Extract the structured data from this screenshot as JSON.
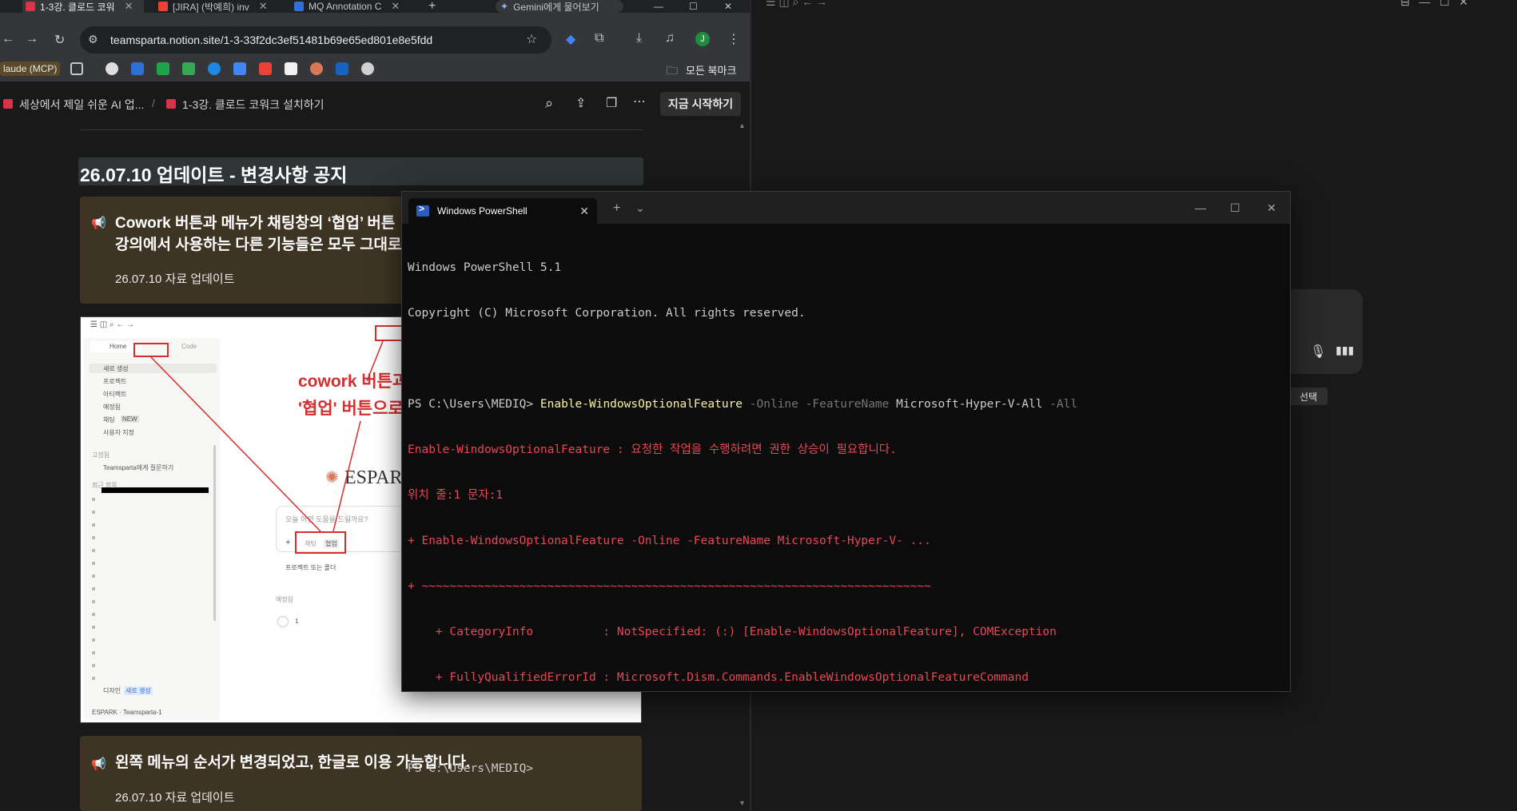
{
  "browser": {
    "tabs": [
      {
        "label": "1-3강. 클로드 코워",
        "active": true
      },
      {
        "label": "[JIRA] (박예희) inv",
        "active": false
      },
      {
        "label": "MQ Annotation C",
        "active": false
      }
    ],
    "gemini_label": "Gemini에게 물어보기",
    "url": "teamsparta.notion.site/1-3-33f2dc3ef51481b69e65ed801e8e5fdd",
    "profile_initial": "J",
    "bookmarks_left_label": "laude (MCP)",
    "all_bookmarks_label": "모든 북마크"
  },
  "notion": {
    "breadcrumb": [
      "세상에서 제일 쉬운 AI 업...",
      "1-3강. 클로드 코워크 설치하기"
    ],
    "start_button": "지금 시작하기",
    "heading": "26.07.10 업데이트 - 변경사항 공지",
    "callout1": {
      "line1": "Cowork 버튼과 메뉴가 채팅창의 ‘협업’ 버튼",
      "line2": "강의에서 사용하는 다른 기능들은 모두 그대로",
      "sub": "26.07.10 자료 업데이트"
    },
    "callout2": {
      "title": "왼쪽 메뉴의 순서가 변경되었고, 한글로 이용 가능합니다.",
      "sub": "26.07.10 자료 업데이트"
    },
    "screenshot": {
      "annotation_line1": "cowork 버튼과",
      "annotation_line2": "'협업' 버튼으로",
      "brand": "ESPARK",
      "tab_home": "Home",
      "tab_code": "Code",
      "menu": [
        "새로 생성",
        "프로젝트",
        "아티팩트",
        "예정됨",
        "채팅",
        "사용자 지정"
      ],
      "menu_badge": "NEW",
      "pinned_label": "고정됨",
      "pinned_item": "Teamsparta에게 질문하기",
      "recent_label": "최근 항목",
      "prompt_placeholder": "오늘 어떤 도움을 드릴까요?",
      "chat_label": "채팅",
      "collab_label": "협업",
      "project_label": "프로젝트 또는 폴더",
      "scheduled_label": "예정됨",
      "scheduled_count": "1",
      "footer_user": "디자인",
      "footer_badge": "새로 생성",
      "footer_org": "ESPARK · Teamsparta-1"
    }
  },
  "right_window": {
    "tooltip": "선택"
  },
  "terminal": {
    "tab_title": "Windows PowerShell",
    "lines": {
      "l1": "Windows PowerShell 5.1",
      "l2": "Copyright (C) Microsoft Corporation. All rights reserved.",
      "prompt": "PS C:\\Users\\MEDIQ>",
      "cmd_name": "Enable-WindowsOptionalFeature",
      "p_online": "-Online",
      "p_feature": "-FeatureName",
      "feature_value": "Microsoft-Hyper-V-All",
      "p_all": "-All",
      "e1": "Enable-WindowsOptionalFeature : 요청한 작업을 수행하려면 권한 상승이 필요합니다.",
      "e2": "위치 줄:1 문자:1",
      "e3": "+ Enable-WindowsOptionalFeature -Online -FeatureName Microsoft-Hyper-V- ...",
      "e4": "+ ~~~~~~~~~~~~~~~~~~~~~~~~~~~~~~~~~~~~~~~~~~~~~~~~~~~~~~~~~~~~~~~~~~~~~~~~~",
      "e5": "    + CategoryInfo          : NotSpecified: (:) [Enable-WindowsOptionalFeature], COMException",
      "e6": "    + FullyQualifiedErrorId : Microsoft.Dism.Commands.EnableWindowsOptionalFeatureCommand",
      "prompt2": "PS C:\\Users\\MEDIQ>"
    }
  }
}
